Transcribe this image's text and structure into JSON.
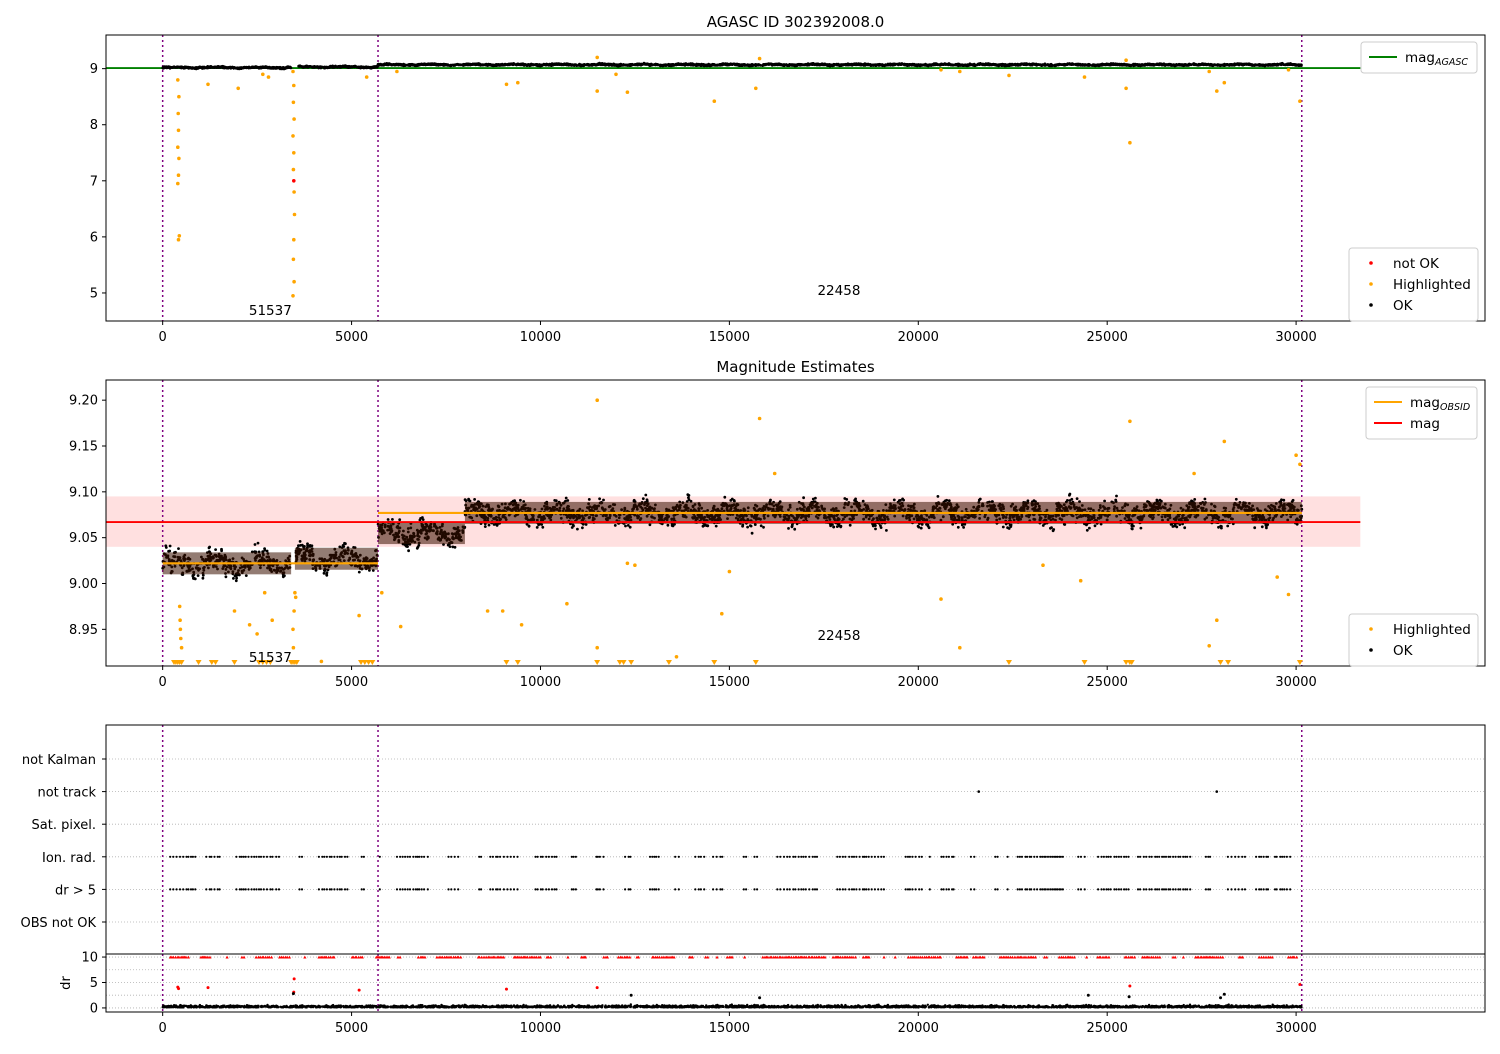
{
  "chart_data": [
    {
      "type": "scatter",
      "title": "AGASC ID 302392008.0",
      "xlim": [
        -1500,
        35000
      ],
      "ylim": [
        4.5,
        9.6
      ],
      "xticks": [
        0,
        5000,
        10000,
        15000,
        20000,
        25000,
        30000
      ],
      "yticks": [
        5,
        6,
        7,
        8,
        9
      ],
      "obsid_boundaries": [
        0,
        5700,
        30150
      ],
      "obsid_labels": [
        {
          "text": "51537",
          "x": 2850,
          "y": 4.7
        },
        {
          "text": "22458",
          "x": 17900,
          "y": 5.05
        }
      ],
      "reference_line": {
        "name": "mag",
        "subscript": "AGASC",
        "value": 9.01,
        "color": "#008000"
      },
      "legends": [
        {
          "placement": "upper right",
          "entries": [
            {
              "label": "mag",
              "sub": "AGASC",
              "kind": "line",
              "color": "#008000"
            }
          ]
        },
        {
          "placement": "lower right",
          "entries": [
            {
              "label": "not OK",
              "kind": "dot",
              "color": "#ff0000"
            },
            {
              "label": "Highlighted",
              "kind": "dot",
              "color": "#ffa500"
            },
            {
              "label": "OK",
              "kind": "dot",
              "color": "#000000"
            }
          ]
        }
      ],
      "series": [
        {
          "name": "OK",
          "color": "#000000",
          "segments": [
            [
              0,
              3400,
              9.02
            ],
            [
              3600,
              5700,
              9.03
            ],
            [
              5700,
              30150,
              9.07
            ]
          ],
          "spread": 0.03
        },
        {
          "name": "Highlighted",
          "color": "#ffa500",
          "points": [
            [
              420,
              5.95
            ],
            [
              440,
              6.02
            ],
            [
              400,
              6.95
            ],
            [
              420,
              7.1
            ],
            [
              430,
              7.4
            ],
            [
              400,
              7.6
            ],
            [
              420,
              7.9
            ],
            [
              410,
              8.2
            ],
            [
              430,
              8.5
            ],
            [
              400,
              8.8
            ],
            [
              3450,
              4.95
            ],
            [
              3480,
              5.2
            ],
            [
              3460,
              5.6
            ],
            [
              3470,
              5.95
            ],
            [
              3490,
              6.4
            ],
            [
              3480,
              6.8
            ],
            [
              3460,
              7.2
            ],
            [
              3470,
              7.5
            ],
            [
              3450,
              7.8
            ],
            [
              3480,
              8.1
            ],
            [
              3460,
              8.4
            ],
            [
              3470,
              8.7
            ],
            [
              3450,
              8.95
            ],
            [
              1200,
              8.72
            ],
            [
              2000,
              8.65
            ],
            [
              2650,
              8.9
            ],
            [
              2800,
              8.85
            ],
            [
              5400,
              8.85
            ],
            [
              6200,
              8.95
            ],
            [
              9100,
              8.72
            ],
            [
              9400,
              8.75
            ],
            [
              11500,
              8.6
            ],
            [
              11500,
              9.2
            ],
            [
              12300,
              8.58
            ],
            [
              12000,
              8.9
            ],
            [
              14600,
              8.42
            ],
            [
              15700,
              8.65
            ],
            [
              15800,
              9.18
            ],
            [
              20600,
              8.98
            ],
            [
              21100,
              8.95
            ],
            [
              22400,
              8.88
            ],
            [
              24400,
              8.85
            ],
            [
              25500,
              9.15
            ],
            [
              25500,
              8.65
            ],
            [
              25600,
              7.68
            ],
            [
              27900,
              8.6
            ],
            [
              28100,
              8.75
            ],
            [
              27700,
              8.95
            ],
            [
              30100,
              8.42
            ],
            [
              29800,
              8.98
            ]
          ]
        },
        {
          "name": "not OK",
          "color": "#ff0000",
          "points": [
            [
              3470,
              7.0
            ]
          ]
        }
      ]
    },
    {
      "type": "scatter",
      "title": "Magnitude Estimates",
      "xlim": [
        -1500,
        35000
      ],
      "ylim": [
        8.91,
        9.222
      ],
      "xticks": [
        0,
        5000,
        10000,
        15000,
        20000,
        25000,
        30000
      ],
      "yticks": [
        8.95,
        9.0,
        9.05,
        9.1,
        9.15,
        9.2
      ],
      "ytick_labels": [
        "8.95",
        "9.00",
        "9.05",
        "9.10",
        "9.15",
        "9.20"
      ],
      "obsid_boundaries": [
        0,
        5700,
        30150
      ],
      "obsid_labels": [
        {
          "text": "51537",
          "x": 2850,
          "y": 8.92
        },
        {
          "text": "22458",
          "x": 17900,
          "y": 8.944
        }
      ],
      "mag_line": {
        "value": 9.067,
        "band": [
          9.04,
          9.095
        ],
        "xmax": 31700,
        "color": "#ff0000"
      },
      "mag_obsid": [
        {
          "x": [
            0,
            5700
          ],
          "value": 9.022
        },
        {
          "x": [
            5700,
            30150
          ],
          "value": 9.077
        }
      ],
      "legends": [
        {
          "placement": "upper right",
          "entries": [
            {
              "label": "mag",
              "sub": "OBSID",
              "kind": "line",
              "color": "#ffa500"
            },
            {
              "label": "mag",
              "kind": "line",
              "color": "#ff0000"
            }
          ]
        },
        {
          "placement": "lower right",
          "entries": [
            {
              "label": "Highlighted",
              "kind": "dot",
              "color": "#ffa500"
            },
            {
              "label": "OK",
              "kind": "dot",
              "color": "#000000"
            }
          ]
        }
      ],
      "series": [
        {
          "name": "OK",
          "color": "#000000",
          "segments": [
            [
              0,
              3400,
              9.022
            ],
            [
              3500,
              5700,
              9.027
            ],
            [
              5700,
              8000,
              9.055
            ],
            [
              8000,
              30150,
              9.077
            ]
          ],
          "spread": 0.025
        },
        {
          "name": "Highlighted",
          "color": "#ffa500",
          "points": [
            [
              450,
              8.975
            ],
            [
              460,
              8.96
            ],
            [
              470,
              8.95
            ],
            [
              480,
              8.94
            ],
            [
              500,
              8.93
            ],
            [
              1900,
              8.97
            ],
            [
              2300,
              8.955
            ],
            [
              2500,
              8.945
            ],
            [
              2700,
              8.99
            ],
            [
              2900,
              8.96
            ],
            [
              3450,
              8.95
            ],
            [
              3460,
              8.93
            ],
            [
              3480,
              8.97
            ],
            [
              3500,
              8.99
            ],
            [
              3520,
              8.985
            ],
            [
              4200,
              8.915
            ],
            [
              5200,
              8.965
            ],
            [
              5800,
              8.99
            ],
            [
              6300,
              8.953
            ],
            [
              8600,
              8.97
            ],
            [
              9000,
              8.97
            ],
            [
              9500,
              8.955
            ],
            [
              10700,
              8.978
            ],
            [
              11500,
              9.2
            ],
            [
              11500,
              8.93
            ],
            [
              12300,
              9.022
            ],
            [
              12500,
              9.02
            ],
            [
              13600,
              8.92
            ],
            [
              14800,
              8.967
            ],
            [
              15000,
              9.013
            ],
            [
              15800,
              9.18
            ],
            [
              16200,
              9.12
            ],
            [
              20600,
              8.983
            ],
            [
              21100,
              8.93
            ],
            [
              23300,
              9.02
            ],
            [
              24300,
              9.003
            ],
            [
              25600,
              9.177
            ],
            [
              27700,
              8.932
            ],
            [
              27900,
              8.96
            ],
            [
              29500,
              9.007
            ],
            [
              29800,
              8.988
            ],
            [
              30000,
              9.14
            ],
            [
              30100,
              9.13
            ],
            [
              28100,
              9.155
            ],
            [
              27300,
              9.12
            ]
          ]
        },
        {
          "name": "Highlighted (below axis)",
          "color": "#ffa500",
          "marker": "triangle-down",
          "x": [
            300,
            350,
            400,
            450,
            500,
            950,
            1300,
            1400,
            1900,
            2550,
            2650,
            2750,
            2850,
            3400,
            3450,
            3500,
            3550,
            5250,
            5350,
            5450,
            5550,
            9100,
            9400,
            11500,
            12100,
            12200,
            12400,
            13400,
            14600,
            15700,
            22400,
            24400,
            25500,
            25600,
            25650,
            28000,
            28200,
            30100
          ]
        }
      ]
    },
    {
      "type": "scatter",
      "title": "",
      "xlim": [
        -1500,
        35000
      ],
      "obsid_boundaries": [
        0,
        5700,
        30150
      ],
      "categories": [
        "not Kalman",
        "not track",
        "Sat. pixel.",
        "Ion. rad.",
        "dr > 5",
        "OBS not OK"
      ],
      "flag_series": {
        "not track": [
          21600,
          27900
        ],
        "Ion. rad.": "intermittent 150 to 30150",
        "dr > 5": "intermittent 150 to 30150"
      },
      "dr_panel": {
        "ylabel": "dr",
        "ylim": [
          -0.8,
          10.6
        ],
        "yticks": [
          0,
          5,
          10
        ],
        "ceiling": 10,
        "not_ok_color": "#ff0000",
        "ok_color": "#000000",
        "spikes": [
          [
            400,
            4.1
          ],
          [
            420,
            3.8
          ],
          [
            1200,
            4.0
          ],
          [
            3480,
            5.7
          ],
          [
            3470,
            3.1
          ],
          [
            3460,
            2.8
          ],
          [
            5200,
            3.5
          ],
          [
            9100,
            3.7
          ],
          [
            11500,
            4.0
          ],
          [
            12400,
            2.5
          ],
          [
            15800,
            2.0
          ],
          [
            24500,
            2.5
          ],
          [
            25600,
            4.3
          ],
          [
            25580,
            2.2
          ],
          [
            28000,
            2.0
          ],
          [
            28100,
            2.7
          ],
          [
            30100,
            4.6
          ]
        ]
      }
    }
  ]
}
